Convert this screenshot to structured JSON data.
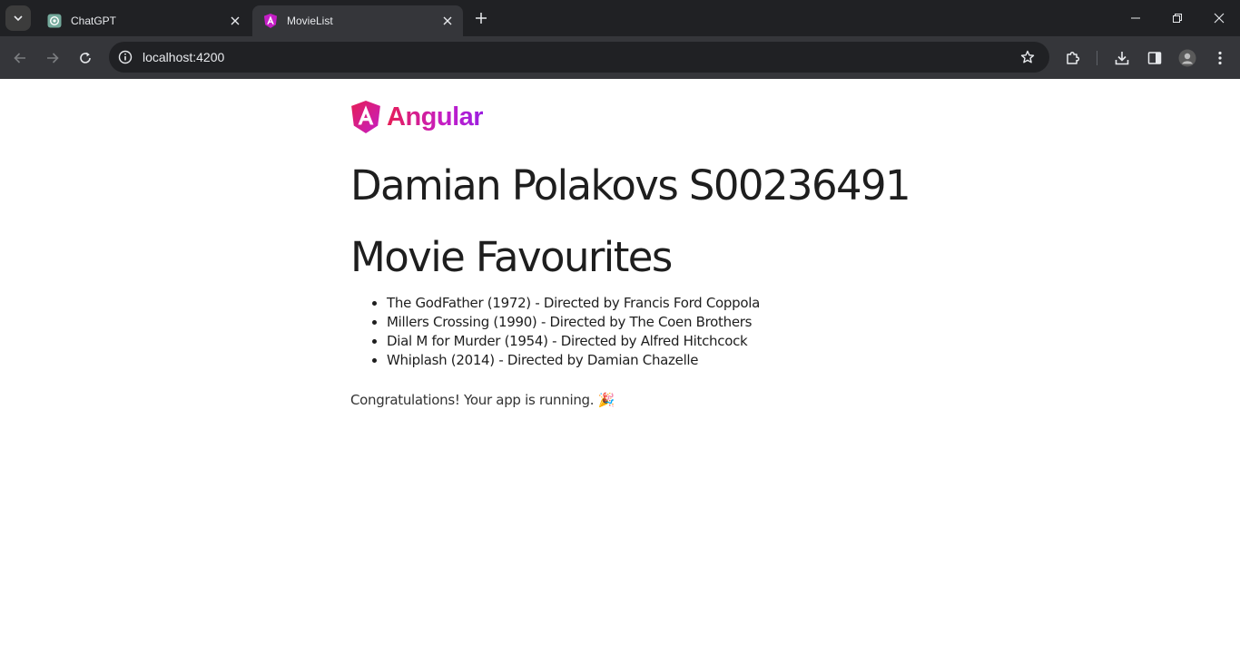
{
  "browser": {
    "tabs": [
      {
        "title": "ChatGPT",
        "icon": "chatgpt-icon",
        "active": false
      },
      {
        "title": "MovieList",
        "icon": "angular-icon",
        "active": true
      }
    ],
    "url": "localhost:4200"
  },
  "page": {
    "logo_text": "Angular",
    "heading": "Damian Polakovs S00236491",
    "subheading": "Movie Favourites",
    "movies": [
      "The GodFather (1972) - Directed by Francis Ford Coppola",
      "Millers Crossing (1990) - Directed by The Coen Brothers",
      "Dial M for Murder (1954) - Directed by Alfred Hitchcock",
      "Whiplash (2014) - Directed by Damian Chazelle"
    ],
    "congrats": "Congratulations! Your app is running. 🎉"
  },
  "colors": {
    "chrome_dark": "#202124",
    "chrome_toolbar": "#35363a",
    "angular_red": "#e61e56",
    "angular_purple": "#9b1ee0",
    "text": "#1e1e1e"
  }
}
